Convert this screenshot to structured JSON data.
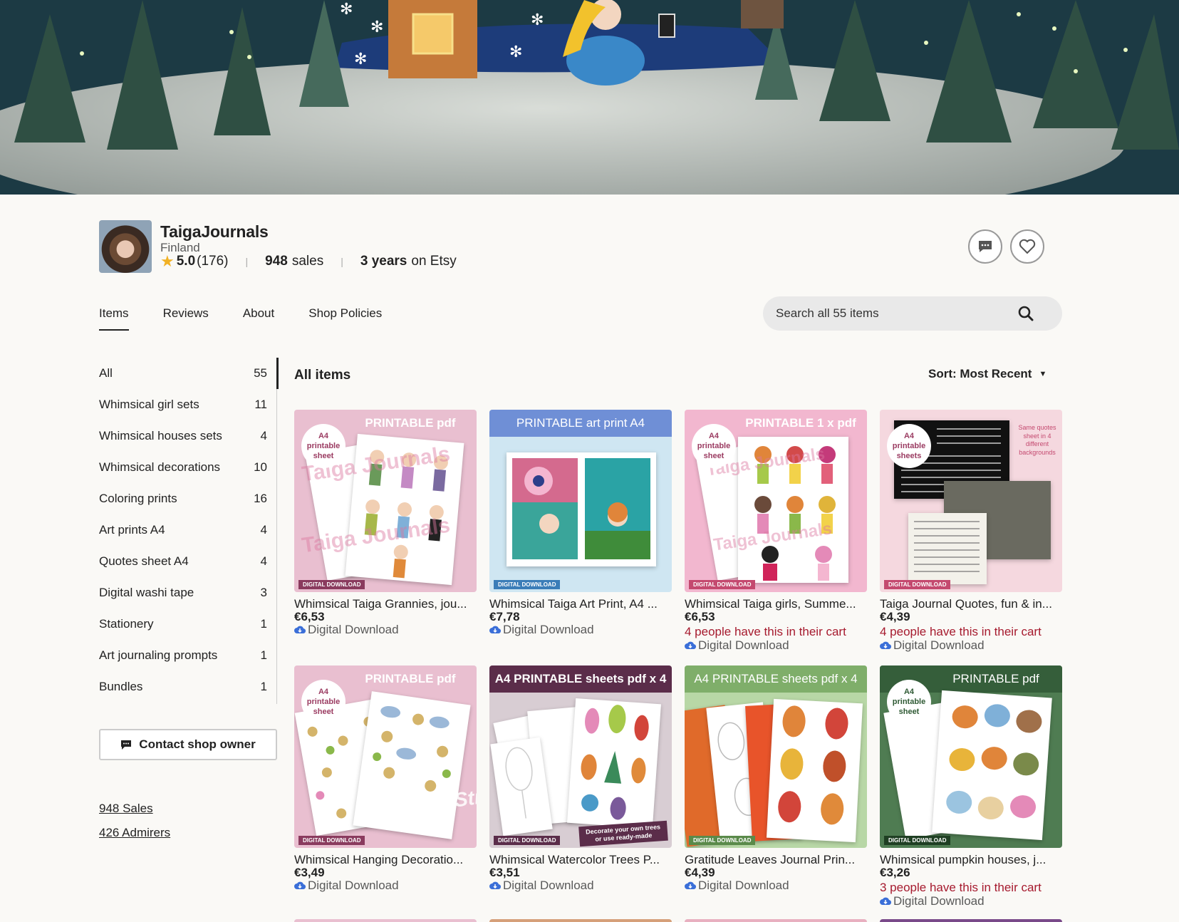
{
  "shop": {
    "name": "TaigaJournals",
    "location": "Finland",
    "rating": "5.0",
    "rating_count": "(176)",
    "sales_num": "948",
    "sales_label": "sales",
    "years_num": "3 years",
    "years_label": "on Etsy"
  },
  "tabs": [
    {
      "label": "Items"
    },
    {
      "label": "Reviews"
    },
    {
      "label": "About"
    },
    {
      "label": "Shop Policies"
    }
  ],
  "search": {
    "placeholder": "Search all 55 items"
  },
  "sidebar": {
    "categories": [
      {
        "label": "All",
        "count": "55"
      },
      {
        "label": "Whimsical girl sets",
        "count": "11"
      },
      {
        "label": "Whimsical houses sets",
        "count": "4"
      },
      {
        "label": "Whimsical decorations",
        "count": "10"
      },
      {
        "label": "Coloring prints",
        "count": "16"
      },
      {
        "label": "Art prints A4",
        "count": "4"
      },
      {
        "label": "Quotes sheet A4",
        "count": "4"
      },
      {
        "label": "Digital washi tape",
        "count": "3"
      },
      {
        "label": "Stationery",
        "count": "1"
      },
      {
        "label": "Art journaling prompts",
        "count": "1"
      },
      {
        "label": "Bundles",
        "count": "1"
      }
    ],
    "contact_label": "Contact shop owner",
    "sales_link": "948 Sales",
    "admirers_link": "426 Admirers"
  },
  "main": {
    "title": "All items",
    "sort_label": "Sort: Most Recent"
  },
  "listings": [
    {
      "title": "Whimsical Taiga Grannies, jou...",
      "price": "€6,53",
      "cart_note": "",
      "download": "Digital Download",
      "thumb_banner": "PRINTABLE pdf",
      "badge": "A4\nprintable\nsheet",
      "watermark": "Taiga Journals",
      "tag": "DIGITAL DOWNLOAD"
    },
    {
      "title": "Whimsical Taiga Art Print, A4 ...",
      "price": "€7,78",
      "cart_note": "",
      "download": "Digital Download",
      "thumb_banner": "PRINTABLE art print A4",
      "badge": "",
      "watermark": "",
      "tag": "DIGITAL DOWNLOAD"
    },
    {
      "title": "Whimsical Taiga girls, Summe...",
      "price": "€6,53",
      "cart_note": "4 people have this in their cart",
      "download": "Digital Download",
      "thumb_banner": "PRINTABLE 1 x pdf",
      "badge": "A4\nprintable\nsheet",
      "watermark": "Taiga Journals",
      "tag": "DIGITAL DOWNLOAD"
    },
    {
      "title": "Taiga Journal Quotes, fun & in...",
      "price": "€4,39",
      "cart_note": "4 people have this in their cart",
      "download": "Digital Download",
      "thumb_banner": "",
      "badge": "A4\nprintable\nsheets",
      "watermark": "",
      "tag": "DIGITAL DOWNLOAD",
      "side_note": "Same quotes sheet in 4 different backgrounds"
    },
    {
      "title": "Whimsical Hanging Decoratio...",
      "price": "€3,49",
      "cart_note": "",
      "download": "Digital Download",
      "thumb_banner": "PRINTABLE pdf",
      "badge": "A4\nprintable\nsheet",
      "watermark": "Whimsy Strings",
      "tag": "DIGITAL DOWNLOAD"
    },
    {
      "title": "Whimsical Watercolor Trees P...",
      "price": "€3,51",
      "cart_note": "",
      "download": "Digital Download",
      "thumb_banner": "A4 PRINTABLE sheets pdf x 4",
      "badge": "",
      "watermark": "",
      "tag": "DIGITAL DOWNLOAD",
      "side_note": "Decorate your own trees or use ready-made"
    },
    {
      "title": "Gratitude Leaves Journal Prin...",
      "price": "€4,39",
      "cart_note": "",
      "download": "Digital Download",
      "thumb_banner": "A4 PRINTABLE sheets pdf x 4",
      "badge": "",
      "watermark": "",
      "tag": "DIGITAL DOWNLOAD"
    },
    {
      "title": "Whimsical pumpkin houses, j...",
      "price": "€3,26",
      "cart_note": "3 people have this in their cart",
      "download": "Digital Download",
      "thumb_banner": "PRINTABLE pdf",
      "badge": "A4\nprintable\nsheet",
      "watermark": "",
      "tag": "DIGITAL DOWNLOAD"
    }
  ],
  "colors": {
    "cart_note": "#a61a2e",
    "download_icon": "#3b6fd8",
    "pink_banner": "#c9779b",
    "blue_banner": "#6f8fd6",
    "purple_banner": "#5b2d4a",
    "green_banner": "#7fae6a",
    "dark_green_banner": "#355e3a"
  }
}
